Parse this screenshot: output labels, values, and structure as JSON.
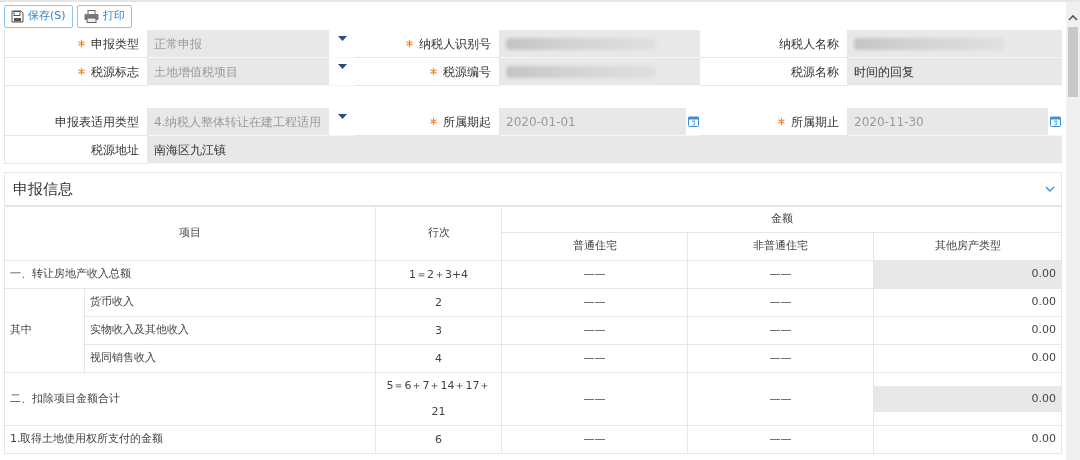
{
  "toolbar": [
    {
      "kind": "save",
      "label": "保存(S)"
    },
    {
      "kind": "print",
      "label": "打印"
    }
  ],
  "form_rows": [
    {
      "fields": [
        {
          "label": "申报类型",
          "required": true,
          "kind": "select",
          "value": "正常申报",
          "disabled": true
        },
        {
          "label": "纳税人识别号",
          "required": true,
          "kind": "redacted"
        },
        {
          "label": "纳税人名称",
          "required": false,
          "kind": "redacted"
        }
      ]
    },
    {
      "fields": [
        {
          "label": "税源标志",
          "required": true,
          "kind": "select",
          "value": "土地增值税项目",
          "disabled": true
        },
        {
          "label": "税源编号",
          "required": true,
          "kind": "redacted"
        },
        {
          "label": "税源名称",
          "required": false,
          "kind": "text",
          "value": "时间的回复",
          "disabled": false
        }
      ]
    },
    {
      "fields": [
        {
          "label": "申报表适用类型",
          "required": false,
          "kind": "select",
          "value": "4.纳税人整体转让在建工程适用",
          "disabled": true
        },
        {
          "label": "所属期起",
          "required": true,
          "kind": "date",
          "value": "2020-01-01",
          "disabled": true
        },
        {
          "label": "所属期止",
          "required": true,
          "kind": "date",
          "value": "2020-11-30",
          "disabled": true
        }
      ]
    },
    {
      "fields": [
        {
          "label": "税源地址",
          "required": false,
          "kind": "wide",
          "value": "南海区九江镇",
          "disabled": false
        }
      ]
    }
  ],
  "section": {
    "title": "申报信息",
    "expanded": true
  },
  "table": {
    "columns": {
      "item": "项目",
      "line": "行次",
      "amount": "金额",
      "amount_columns": [
        "普通住宅",
        "非普通住宅",
        "其他房产类型"
      ]
    },
    "rows": [
      {
        "kind": "main",
        "item": "一、转让房地产收入总额",
        "line": "1＝2＋3+4",
        "cells": [
          {
            "value": "——",
            "readonly": false
          },
          {
            "value": "——",
            "readonly": false
          },
          {
            "value": "0.00",
            "readonly": true
          }
        ]
      },
      {
        "kind": "group",
        "item": "其中",
        "children": [
          {
            "item": "货币收入",
            "line": "2",
            "cells": [
              {
                "value": "——",
                "readonly": false
              },
              {
                "value": "——",
                "readonly": false
              },
              {
                "value": "0.00",
                "readonly": false
              }
            ]
          },
          {
            "item": "实物收入及其他收入",
            "line": "3",
            "cells": [
              {
                "value": "——",
                "readonly": false
              },
              {
                "value": "——",
                "readonly": false
              },
              {
                "value": "0.00",
                "readonly": false
              }
            ]
          },
          {
            "item": "视同销售收入",
            "line": "4",
            "cells": [
              {
                "value": "——",
                "readonly": false
              },
              {
                "value": "——",
                "readonly": false
              },
              {
                "value": "0.00",
                "readonly": false
              }
            ]
          }
        ]
      },
      {
        "kind": "main",
        "item": "二、扣除项目金额合计",
        "line": "5＝6＋7＋14＋17＋ 21",
        "cells": [
          {
            "value": "——",
            "readonly": false
          },
          {
            "value": "——",
            "readonly": false
          },
          {
            "value": "0.00",
            "readonly": true
          }
        ]
      },
      {
        "kind": "main",
        "item": "1.取得土地使用权所支付的金额",
        "line": "6",
        "cells": [
          {
            "value": "——",
            "readonly": false
          },
          {
            "value": "——",
            "readonly": false
          },
          {
            "value": "0.00",
            "readonly": false
          }
        ]
      }
    ]
  }
}
